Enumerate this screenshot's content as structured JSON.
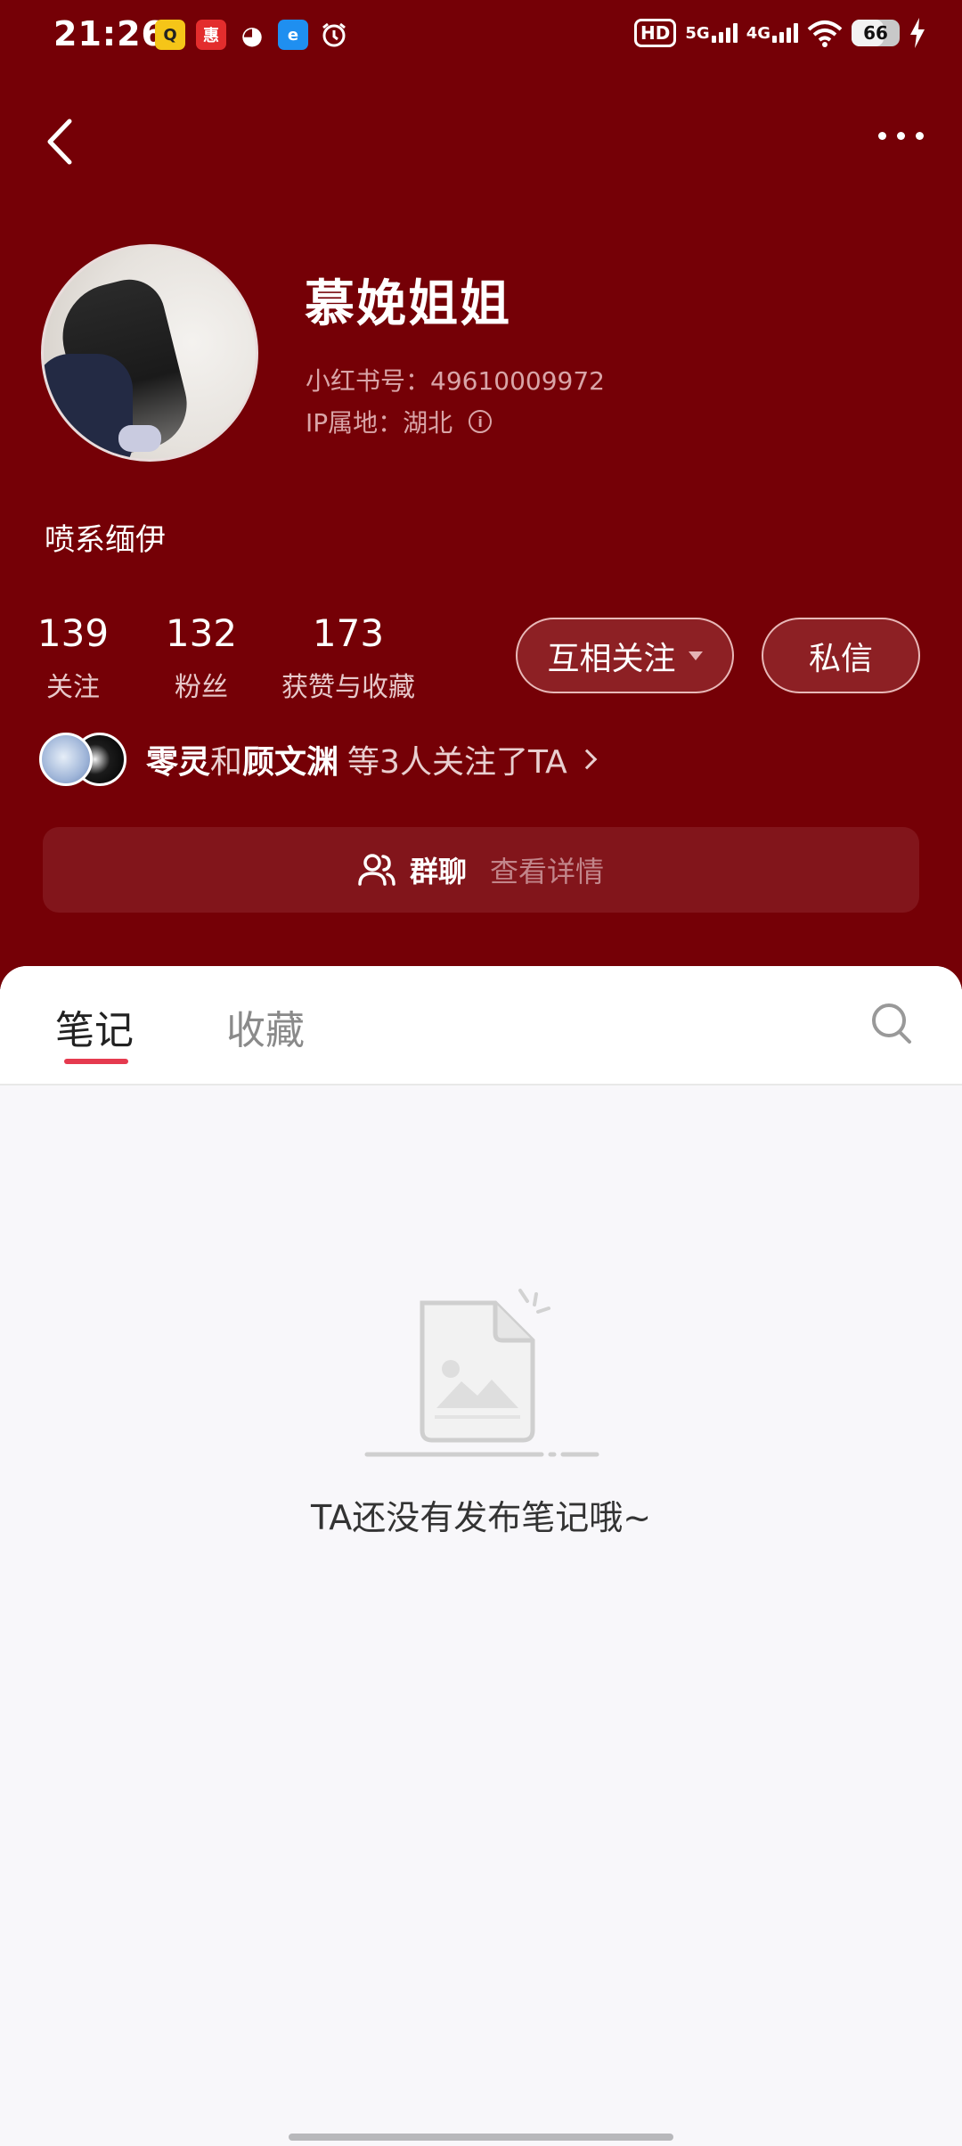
{
  "status_bar": {
    "time": "21:26",
    "hd": "HD",
    "net1": "5G",
    "net2": "4G",
    "battery": "66",
    "app_icons": [
      "qq-icon",
      "app-red-icon",
      "wechat-icon",
      "browser-icon",
      "alarm-icon"
    ]
  },
  "profile": {
    "nickname": "慕娩姐姐",
    "red_id": "小红书号：49610009972",
    "ip": "IP属地：湖北",
    "bio": "喷系缅伊"
  },
  "stats": {
    "following_count": "139",
    "following_label": "关注",
    "fans_count": "132",
    "fans_label": "粉丝",
    "likes_count": "173",
    "likes_label": "获赞与收藏"
  },
  "actions": {
    "mutual_follow": "互相关注",
    "message": "私信"
  },
  "mutual_friends": {
    "name1": "零灵",
    "conj": "和",
    "name2": "顾文渊",
    "suffix": "等3人关注了TA"
  },
  "group_chat": {
    "label": "群聊",
    "detail": "查看详情"
  },
  "tabs": {
    "notes": "笔记",
    "collections": "收藏"
  },
  "empty_state": {
    "message": "TA还没有发布笔记哦~"
  },
  "colors": {
    "header_bg": "#750006",
    "accent": "#e53a4f"
  }
}
